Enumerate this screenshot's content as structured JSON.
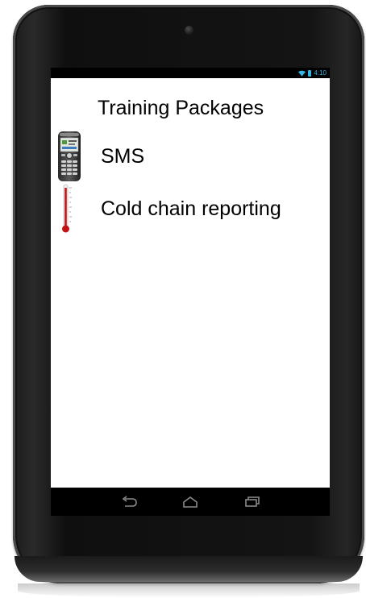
{
  "status_bar": {
    "time": "4:10",
    "icons": [
      "wifi-icon",
      "battery-icon"
    ],
    "accent_color": "#33b5e5"
  },
  "app": {
    "title": "Training Packages",
    "items": [
      {
        "label": "SMS",
        "icon": "mobile-phone-icon"
      },
      {
        "label": "Cold chain reporting",
        "icon": "thermometer-icon"
      }
    ]
  },
  "nav_bar": {
    "buttons": [
      "back-icon",
      "home-icon",
      "recent-apps-icon"
    ]
  }
}
